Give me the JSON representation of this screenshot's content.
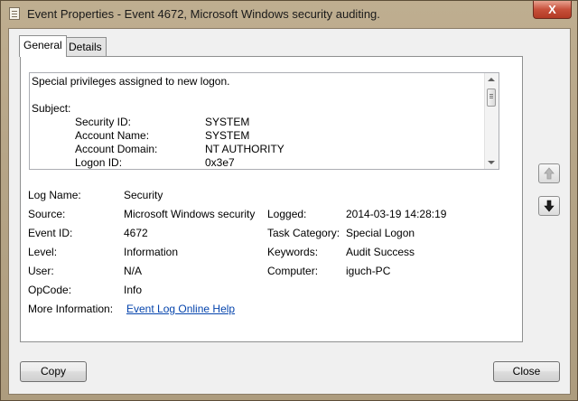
{
  "window": {
    "title": "Event Properties - Event 4672, Microsoft Windows security auditing.",
    "close_glyph": "X"
  },
  "tabs": [
    {
      "label": "General",
      "active": true
    },
    {
      "label": "Details",
      "active": false
    }
  ],
  "description": {
    "headline": "Special privileges assigned to new logon.",
    "section": "Subject:",
    "fields": [
      {
        "label": "Security ID:",
        "value": "SYSTEM"
      },
      {
        "label": "Account Name:",
        "value": "SYSTEM"
      },
      {
        "label": "Account Domain:",
        "value": "NT AUTHORITY"
      },
      {
        "label": "Logon ID:",
        "value": "0x3e7"
      }
    ]
  },
  "props": {
    "log_name": {
      "label": "Log Name:",
      "value": "Security"
    },
    "source": {
      "label": "Source:",
      "value": "Microsoft Windows security"
    },
    "logged": {
      "label": "Logged:",
      "value": "2014-03-19 14:28:19"
    },
    "event_id": {
      "label": "Event ID:",
      "value": "4672"
    },
    "task_category": {
      "label": "Task Category:",
      "value": "Special Logon"
    },
    "level": {
      "label": "Level:",
      "value": "Information"
    },
    "keywords": {
      "label": "Keywords:",
      "value": "Audit Success"
    },
    "user": {
      "label": "User:",
      "value": "N/A"
    },
    "computer": {
      "label": "Computer:",
      "value": "iguch-PC"
    },
    "opcode": {
      "label": "OpCode:",
      "value": "Info"
    },
    "more_info": {
      "label": "More Information:",
      "value": "Event Log Online Help"
    }
  },
  "buttons": {
    "copy": "Copy",
    "close": "Close"
  },
  "icons": {
    "nav_up": "arrow-up-icon",
    "nav_down": "arrow-down-icon",
    "title": "event-properties-icon"
  }
}
